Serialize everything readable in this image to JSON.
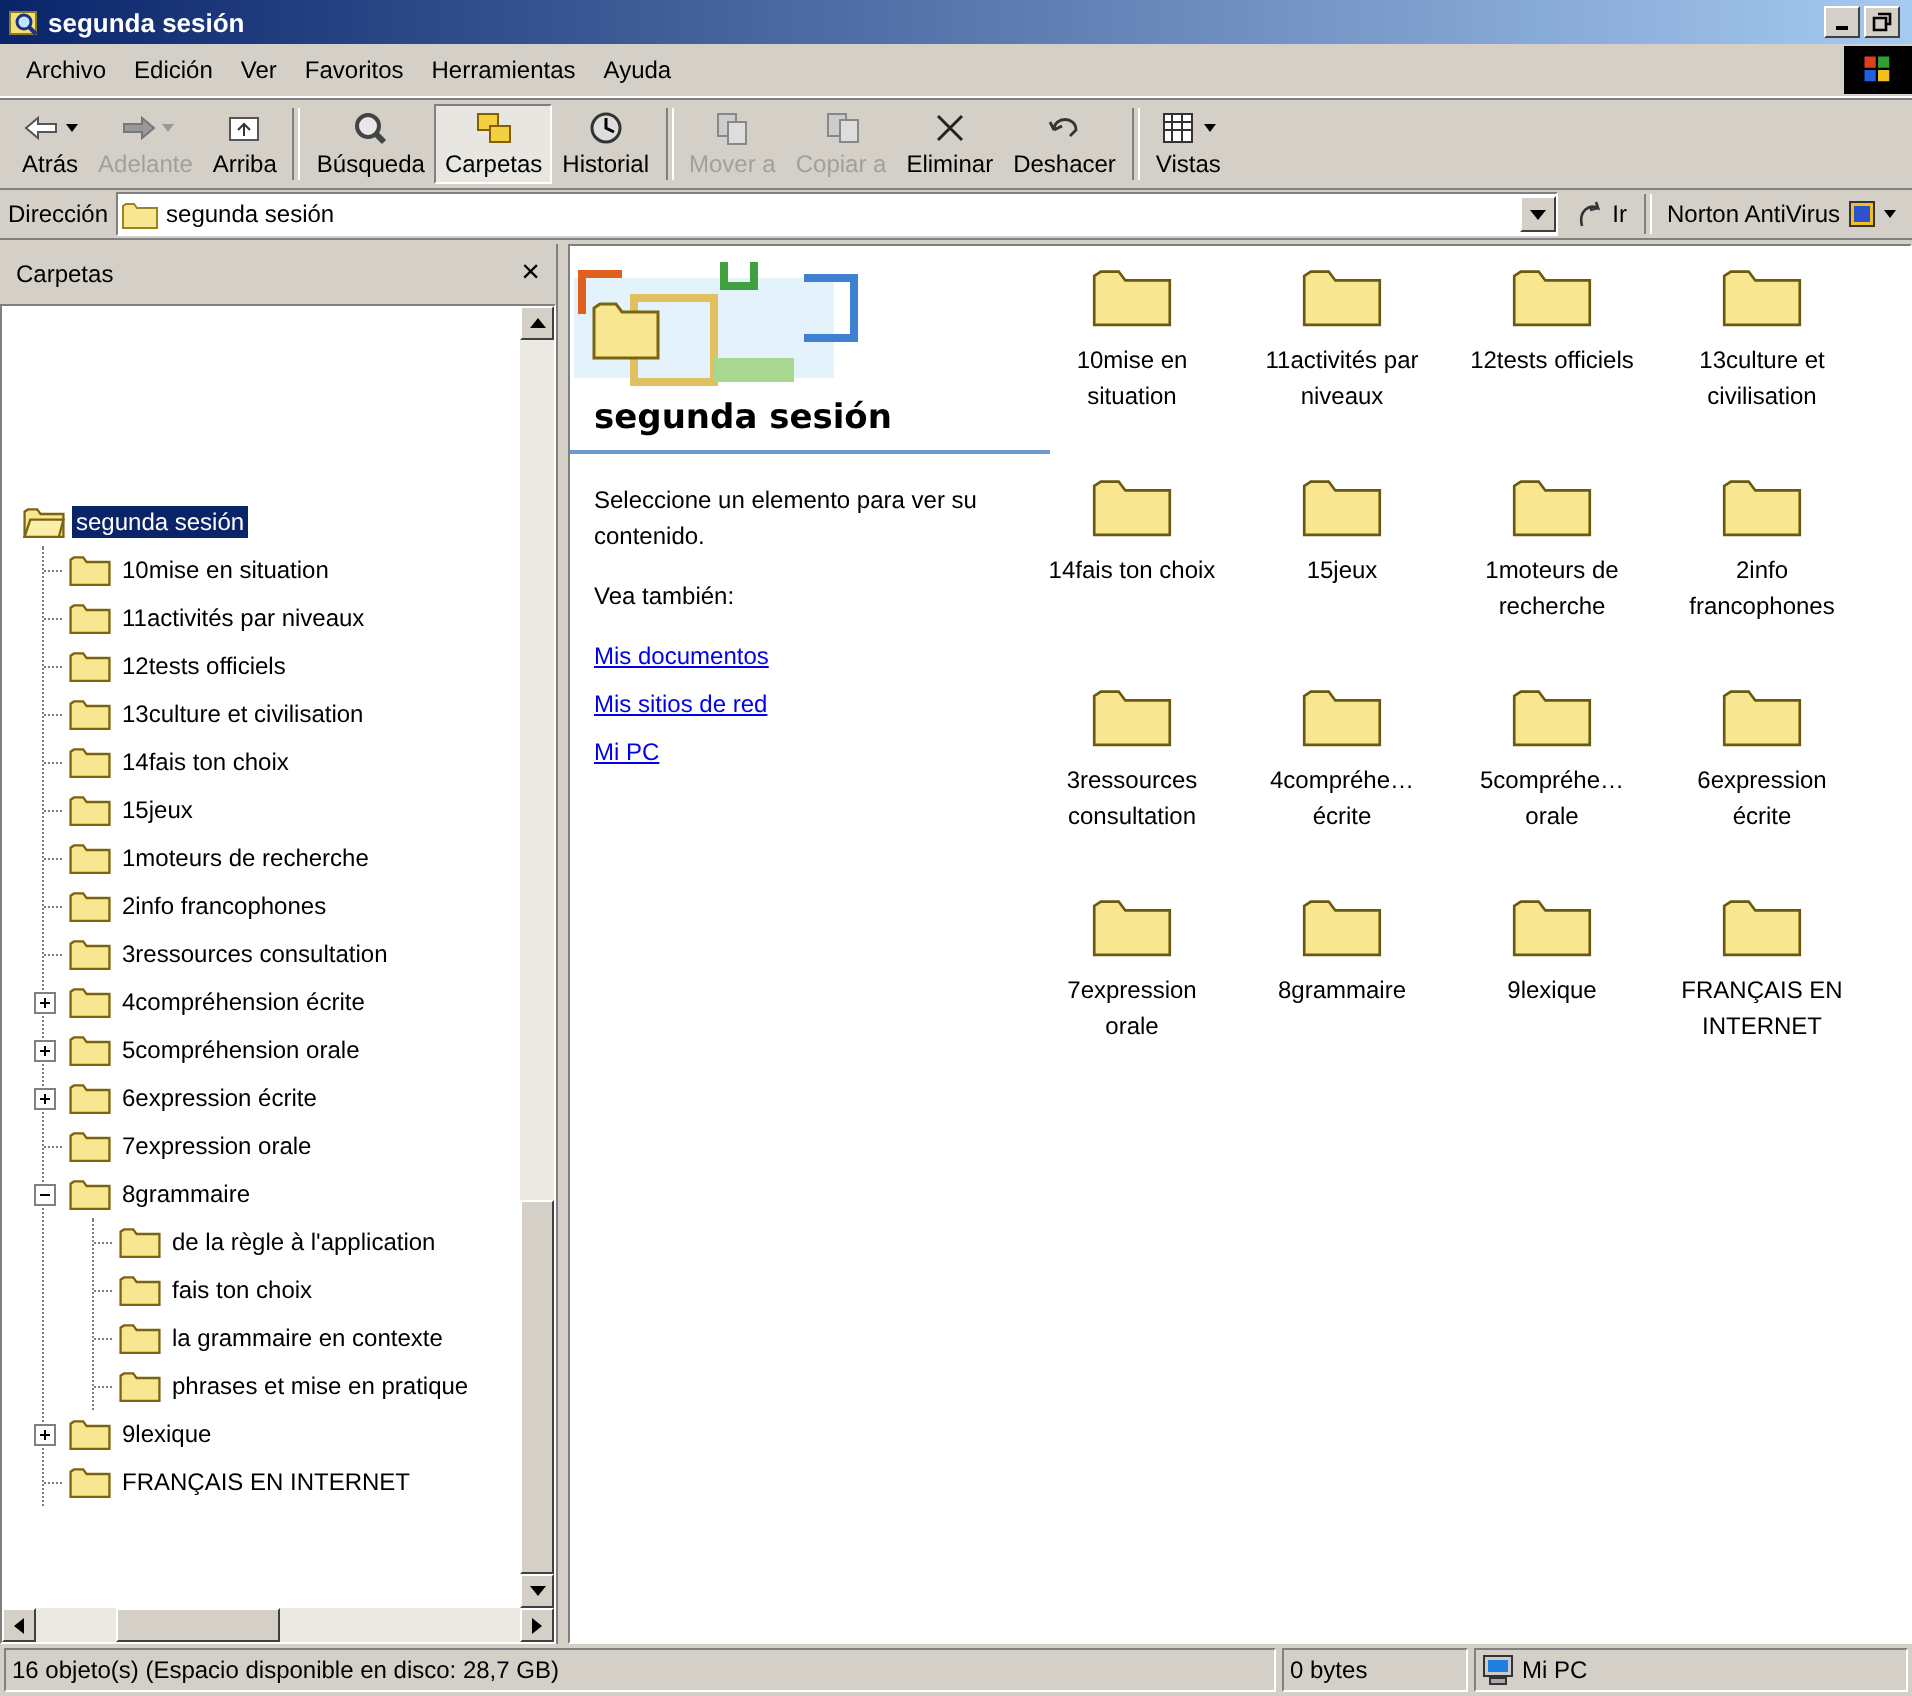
{
  "window": {
    "title": "segunda sesión"
  },
  "menu": [
    "Archivo",
    "Edición",
    "Ver",
    "Favoritos",
    "Herramientas",
    "Ayuda"
  ],
  "toolbar": [
    {
      "kind": "back",
      "label": "Atrás",
      "disabled": false,
      "selected": false,
      "dropdown": true,
      "group_end": false
    },
    {
      "kind": "forward",
      "label": "Adelante",
      "disabled": true,
      "selected": false,
      "dropdown": true,
      "group_end": false
    },
    {
      "kind": "up",
      "label": "Arriba",
      "disabled": false,
      "selected": false,
      "dropdown": false,
      "group_end": true
    },
    {
      "kind": "search",
      "label": "Búsqueda",
      "disabled": false,
      "selected": false,
      "dropdown": false,
      "group_end": false
    },
    {
      "kind": "folders",
      "label": "Carpetas",
      "disabled": false,
      "selected": true,
      "dropdown": false,
      "group_end": false
    },
    {
      "kind": "history",
      "label": "Historial",
      "disabled": false,
      "selected": false,
      "dropdown": false,
      "group_end": true
    },
    {
      "kind": "move",
      "label": "Mover a",
      "disabled": true,
      "selected": false,
      "dropdown": false,
      "group_end": false
    },
    {
      "kind": "copy",
      "label": "Copiar a",
      "disabled": true,
      "selected": false,
      "dropdown": false,
      "group_end": false
    },
    {
      "kind": "delete",
      "label": "Eliminar",
      "disabled": false,
      "selected": false,
      "dropdown": false,
      "group_end": false
    },
    {
      "kind": "undo",
      "label": "Deshacer",
      "disabled": false,
      "selected": false,
      "dropdown": false,
      "group_end": true
    },
    {
      "kind": "views",
      "label": "Vistas",
      "disabled": false,
      "selected": false,
      "dropdown": true,
      "group_end": false
    }
  ],
  "address": {
    "label": "Dirección",
    "value": "segunda sesión",
    "go": "Ir",
    "addon": "Norton AntiVirus"
  },
  "folders_pane": {
    "title": "Carpetas",
    "close": "×",
    "root": {
      "label": "segunda sesión",
      "selected": true,
      "children": [
        {
          "label": "10mise en situation",
          "selected": false
        },
        {
          "label": "11activités par niveaux",
          "selected": false
        },
        {
          "label": "12tests officiels",
          "selected": false
        },
        {
          "label": "13culture et civilisation",
          "selected": false
        },
        {
          "label": "14fais ton choix",
          "selected": false
        },
        {
          "label": "15jeux",
          "selected": false
        },
        {
          "label": "1moteurs de recherche",
          "selected": false
        },
        {
          "label": "2info francophones",
          "selected": false
        },
        {
          "label": "3ressources consultation",
          "selected": false
        },
        {
          "label": "4compréhension écrite",
          "selected": false,
          "expanded": false
        },
        {
          "label": "5compréhension orale",
          "selected": false,
          "expanded": false
        },
        {
          "label": "6expression écrite",
          "selected": false,
          "expanded": false
        },
        {
          "label": "7expression orale",
          "selected": false
        },
        {
          "label": "8grammaire",
          "selected": false,
          "expanded": true,
          "children": [
            {
              "label": "de la règle à l'application",
              "selected": false
            },
            {
              "label": "fais ton choix",
              "selected": false
            },
            {
              "label": "la grammaire en contexte",
              "selected": false
            },
            {
              "label": "phrases et mise en pratique",
              "selected": false
            }
          ]
        },
        {
          "label": "9lexique",
          "selected": false,
          "expanded": false
        },
        {
          "label": "FRANÇAIS EN INTERNET",
          "selected": false
        }
      ]
    }
  },
  "info_panel": {
    "title": "segunda sesión",
    "description": "Seleccione un elemento para ver su contenido.",
    "see_also": "Vea también:",
    "links": [
      "Mis documentos",
      "Mis sitios de red",
      "Mi PC"
    ]
  },
  "items": [
    {
      "label": "10mise en situation"
    },
    {
      "label": "11activités par niveaux"
    },
    {
      "label": "12tests officiels"
    },
    {
      "label": "13culture et civilisation"
    },
    {
      "label": "14fais ton choix"
    },
    {
      "label": "15jeux"
    },
    {
      "label": "1moteurs de recherche"
    },
    {
      "label": "2info francophones"
    },
    {
      "label": "3ressources consultation"
    },
    {
      "label": "4compréhe… écrite"
    },
    {
      "label": "5compréhe… orale"
    },
    {
      "label": "6expression écrite"
    },
    {
      "label": "7expression orale"
    },
    {
      "label": "8grammaire"
    },
    {
      "label": "9lexique"
    },
    {
      "label": "FRANÇAIS EN INTERNET"
    }
  ],
  "status_bar": {
    "objects": "16 objeto(s) (Espacio disponible en disco: 28,7 GB)",
    "size": "0 bytes",
    "zone": "Mi PC"
  }
}
